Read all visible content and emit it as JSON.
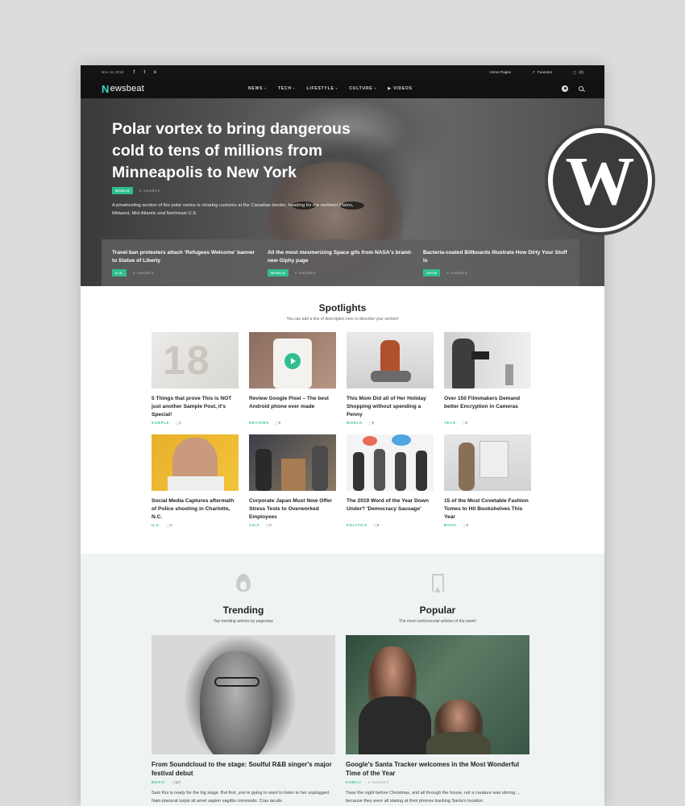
{
  "topbar": {
    "date": "Nov 19, 2019",
    "social": [
      "facebook-icon",
      "twitter-icon",
      "snapchat-icon"
    ],
    "links": [
      "Home Pages",
      "Features",
      "(0)"
    ]
  },
  "nav": {
    "logo_mark": "N",
    "logo_text_a": "ews",
    "logo_text_b": "beat",
    "items": [
      "NEWS",
      "TECH",
      "LIFESTYLE",
      "CULTURE",
      "VIDEOS"
    ]
  },
  "hero": {
    "title": "Polar vortex to bring dangerous cold to tens of millions from Minneapolis to New York",
    "category": "WORLD",
    "shares": "0 SHARES",
    "description": "A pinwheeling section of the polar vortex is clearing customs at the Canadian border, heading for the northern Plains, Midwest, Mid-Atlantic and Northeast U.S.",
    "strip": [
      {
        "title": "Travel ban protesters attach 'Refugees Welcome' banner to Statue of Liberty",
        "category": "U.S.",
        "shares": "0 SHARES"
      },
      {
        "title": "All the most mesmerizing Space gifs from NASA's brand-new Giphy page",
        "category": "WORLD",
        "shares": "0 SHARES"
      },
      {
        "title": "Bacteria-coated Billboards Illustrate How Dirty Your Stuff Is",
        "category": "TECH",
        "shares": "0 SHARES"
      }
    ]
  },
  "spotlights": {
    "title": "Spotlights",
    "subtitle": "You can add a line of description here to describe your section!",
    "cards": [
      {
        "title": "5 Things that prove This is NOT just another Sample Post, it's Special!",
        "category": "SAMPLE",
        "comments": "1"
      },
      {
        "title": "Review Google Pixel – The best Android phone ever made",
        "category": "REVIEWS",
        "comments": "0"
      },
      {
        "title": "This Mom Did all of Her Holiday Shopping without spending a Penny",
        "category": "WORLD",
        "comments": "0"
      },
      {
        "title": "Over 150 Filmmakers Demand better Encryption in Cameras",
        "category": "TECH",
        "comments": "0"
      },
      {
        "title": "Social Media Captures aftermath of Police shooting in Charlotte, N.C.",
        "category": "U.S.",
        "comments": "0"
      },
      {
        "title": "Corporate Japan Must Now Offer Stress Tests to Overworked Employees",
        "category": "ASIA",
        "comments": "0"
      },
      {
        "title": "The 2019 Word of the Year Down Under? 'Democracy Sausage'",
        "category": "POLITICS",
        "comments": "0"
      },
      {
        "title": "15 of the Most Covetable Fashion Tomes to Hit Bookshelves This Year",
        "category": "BOOK",
        "comments": "0"
      }
    ]
  },
  "trending": {
    "title": "Trending",
    "subtitle": "Top trending articles by pageview",
    "article": {
      "title": "From Soundcloud to the stage: Soulful R&B singer's major festival debut",
      "category": "MUSIC",
      "shares": "117",
      "excerpt": "Sam Rui is ready for the big stage. But first, you're going to want to listen to her unplugged. Nam placerat turpis sit amet sapien sagittis commodo. Cras iaculis"
    }
  },
  "popular": {
    "title": "Popular",
    "subtitle": "The most controversial articles of the week!",
    "article": {
      "title": "Google's Santa Tracker welcomes in the Most Wonderful Time of the Year",
      "category": "FAMILY",
      "shares": "0 SHARES",
      "excerpt": "Twas the night before Christmas, and all through the house, not a creature was stirring ... because they were all staring at their phones tracking Santa's location"
    }
  },
  "colors": {
    "accent": "#2fbf8f",
    "logo": "#3fd5c1",
    "nav_bg": "#111111"
  }
}
